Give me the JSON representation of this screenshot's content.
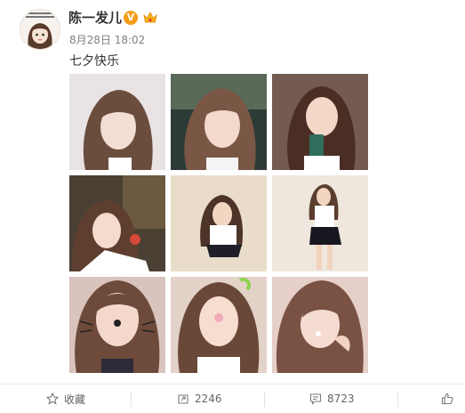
{
  "post": {
    "username": "陈一发儿",
    "verified_badge": "V",
    "timestamp": "8月28日 18:02",
    "text": "七夕快乐"
  },
  "photos": [
    {
      "label": "photo-1"
    },
    {
      "label": "photo-2"
    },
    {
      "label": "photo-3"
    },
    {
      "label": "photo-4"
    },
    {
      "label": "photo-5"
    },
    {
      "label": "photo-6"
    },
    {
      "label": "photo-7"
    },
    {
      "label": "photo-8"
    },
    {
      "label": "photo-9"
    }
  ],
  "actions": {
    "favorite_label": "收藏",
    "repost_count": "2246",
    "comment_count": "8723"
  },
  "icons": {
    "favorite": "star-icon",
    "repost": "repost-icon",
    "comment": "comment-icon",
    "like": "thumbs-up-icon"
  },
  "colors": {
    "verified_orange": "#f59c18",
    "text_primary": "#333333",
    "text_secondary": "#808080"
  }
}
